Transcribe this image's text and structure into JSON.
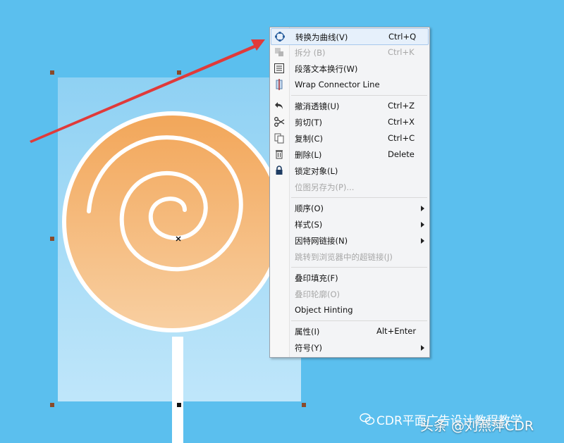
{
  "context_menu": {
    "items": [
      {
        "label": "转换为曲线(V)",
        "shortcut": "Ctrl+Q",
        "icon": "convert-to-curves-icon",
        "disabled": false
      },
      {
        "label": "拆分 (B)",
        "shortcut": "Ctrl+K",
        "icon": "break-apart-icon",
        "disabled": true
      },
      {
        "label": "段落文本换行(W)",
        "shortcut": "",
        "icon": "wrap-text-icon",
        "disabled": false
      },
      {
        "label": "Wrap Connector Line",
        "shortcut": "",
        "icon": "wrap-connector-icon",
        "disabled": false
      },
      {
        "label": "撤消透镜(U)",
        "shortcut": "Ctrl+Z",
        "icon": "undo-icon",
        "disabled": false
      },
      {
        "label": "剪切(T)",
        "shortcut": "Ctrl+X",
        "icon": "scissors-icon",
        "disabled": false
      },
      {
        "label": "复制(C)",
        "shortcut": "Ctrl+C",
        "icon": "copy-icon",
        "disabled": false
      },
      {
        "label": "删除(L)",
        "shortcut": "Delete",
        "icon": "trash-icon",
        "disabled": false
      },
      {
        "label": "锁定对象(L)",
        "shortcut": "",
        "icon": "lock-icon",
        "disabled": false
      },
      {
        "label": "位图另存为(P)...",
        "shortcut": "",
        "icon": "",
        "disabled": true
      },
      {
        "label": "顺序(O)",
        "shortcut": "",
        "icon": "",
        "disabled": false,
        "submenu": true
      },
      {
        "label": "样式(S)",
        "shortcut": "",
        "icon": "",
        "disabled": false,
        "submenu": true
      },
      {
        "label": "因特网链接(N)",
        "shortcut": "",
        "icon": "",
        "disabled": false,
        "submenu": true
      },
      {
        "label": "跳转到浏览器中的超链接(J)",
        "shortcut": "",
        "icon": "",
        "disabled": true
      },
      {
        "label": "叠印填充(F)",
        "shortcut": "",
        "icon": "",
        "disabled": false
      },
      {
        "label": "叠印轮廓(O)",
        "shortcut": "",
        "icon": "",
        "disabled": true
      },
      {
        "label": "Object Hinting",
        "shortcut": "",
        "icon": "",
        "disabled": false
      },
      {
        "label": "属性(I)",
        "shortcut": "Alt+Enter",
        "icon": "",
        "disabled": false
      },
      {
        "label": "符号(Y)",
        "shortcut": "",
        "icon": "",
        "disabled": false,
        "submenu": true
      }
    ]
  },
  "watermark": {
    "channel": "CDR平面广告设计教程教学",
    "credit": "头条 @刘燕萍CDR"
  },
  "colors": {
    "background": "#5bbfee",
    "lollipop_fill": "#f2a659",
    "arrow": "#e03a3a",
    "menu_bg": "#f3f4f6"
  }
}
